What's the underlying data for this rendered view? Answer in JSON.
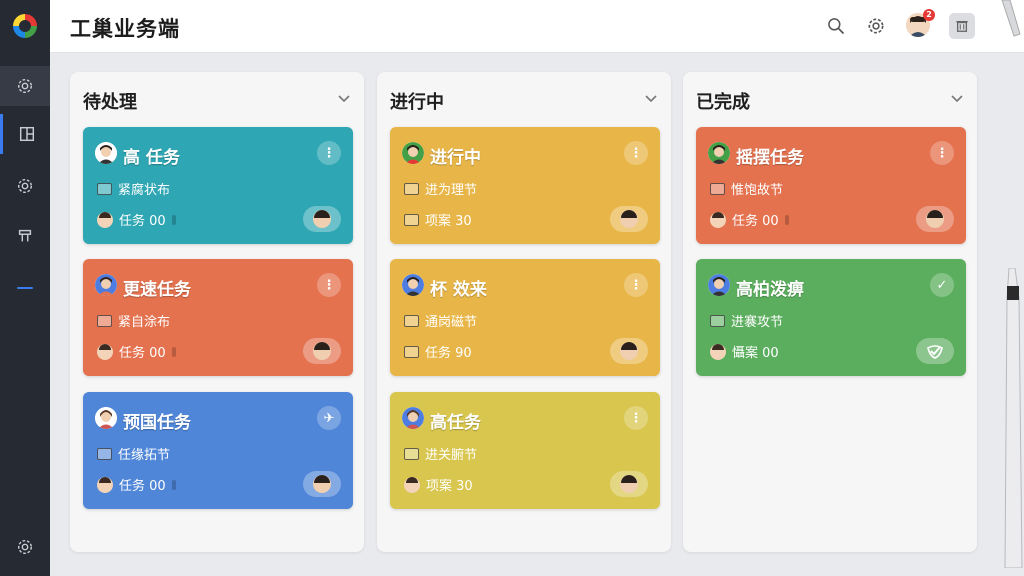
{
  "app": {
    "title": "工巢业务端"
  },
  "sidebar": {
    "items": [
      {
        "icon": "gear-icon"
      },
      {
        "icon": "dashboard-icon"
      },
      {
        "icon": "settings-cog-icon"
      },
      {
        "icon": "tool-icon"
      }
    ],
    "bottom_icon": "settings-icon"
  },
  "header": {
    "notification_count": "2",
    "icons": [
      "search-icon",
      "gear-icon",
      "user-avatar",
      "trash-icon"
    ]
  },
  "colors": {
    "teal": "#2ea6b3",
    "orange": "#e4724f",
    "blue": "#4f86d8",
    "yellow": "#e8b648",
    "olive_yellow": "#d8c64e",
    "green": "#5bae5e"
  },
  "columns": [
    {
      "title": "待处理",
      "cards": [
        {
          "title": "高 任务",
          "detail": "紧腐状布",
          "task": "任务 00",
          "color": "teal",
          "more": "⋮"
        },
        {
          "title": "更速任务",
          "detail": "紧自涂布",
          "task": "任务 00",
          "color": "orange",
          "more": "⋮"
        },
        {
          "title": "预国任务",
          "detail": "任缘拓节",
          "task": "任务 00",
          "color": "blue",
          "more": "✈"
        }
      ]
    },
    {
      "title": "进行中",
      "cards": [
        {
          "title": "进行中",
          "detail": "进为理节",
          "task": "项案 30",
          "color": "yellow",
          "more": "⋮"
        },
        {
          "title": "杯 效来",
          "detail": "通岗磁节",
          "task": "任务 90",
          "color": "yellow",
          "more": "⋮"
        },
        {
          "title": "高任务",
          "detail": "进关腑节",
          "task": "项案 30",
          "color": "olive_yellow",
          "more": "⋮"
        }
      ]
    },
    {
      "title": "已完成",
      "cards": [
        {
          "title": "摇摆任务",
          "detail": "惟饱故节",
          "task": "任务 00",
          "color": "orange",
          "more": "⋮"
        },
        {
          "title": "高柏泼痹",
          "detail": "进褰攻节",
          "task": "懾案 00",
          "color": "green",
          "more": "✓"
        }
      ]
    }
  ]
}
